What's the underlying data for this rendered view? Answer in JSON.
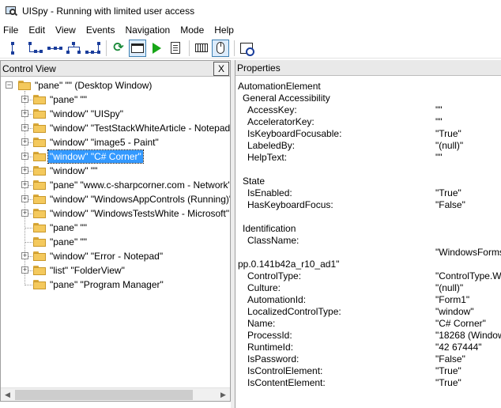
{
  "window": {
    "title": "UISpy - Running with limited user access"
  },
  "menu": [
    "File",
    "Edit",
    "View",
    "Events",
    "Navigation",
    "Mode",
    "Help"
  ],
  "toolbar": {
    "buttons": [
      "parent-icon",
      "first-child-icon",
      "next-sibling-icon",
      "previous-sibling-icon",
      "last-child-icon",
      "refresh-icon",
      "window-icon",
      "play-icon",
      "document-icon",
      "keyboard-icon",
      "mouse-icon",
      "focus-tracking-icon"
    ]
  },
  "control_view": {
    "title": "Control View",
    "close_label": "X",
    "root": "\"pane\" \"\" (Desktop Window)",
    "children": [
      {
        "label": "\"pane\" \"\"",
        "expandable": true
      },
      {
        "label": "\"window\" \"UISpy\"",
        "expandable": true
      },
      {
        "label": "\"window\" \"TestStackWhiteArticle - Notepad\"",
        "expandable": true
      },
      {
        "label": "\"window\" \"image5 - Paint\"",
        "expandable": true
      },
      {
        "label": "\"window\" \"C# Corner\"",
        "expandable": true,
        "selected": true
      },
      {
        "label": "\"window\" \"\"",
        "expandable": true
      },
      {
        "label": "\"pane\" \"www.c-sharpcorner.com - Network\"",
        "expandable": true
      },
      {
        "label": "\"window\" \"WindowsAppControls (Running)\"",
        "expandable": true
      },
      {
        "label": "\"window\" \"WindowsTestsWhite - Microsoft\"",
        "expandable": true
      },
      {
        "label": "\"pane\" \"\"",
        "expandable": false
      },
      {
        "label": "\"pane\" \"\"",
        "expandable": false
      },
      {
        "label": "\"window\" \"Error - Notepad\"",
        "expandable": true
      },
      {
        "label": "\"list\" \"FolderView\"",
        "expandable": true
      },
      {
        "label": "\"pane\" \"Program Manager\"",
        "expandable": false
      }
    ]
  },
  "properties": {
    "title": "Properties",
    "rows": [
      {
        "key": "AutomationElement",
        "value": "",
        "indent": 0
      },
      {
        "key": "General Accessibility",
        "value": "",
        "indent": 1
      },
      {
        "key": "AccessKey:",
        "value": "\"\"",
        "indent": 2
      },
      {
        "key": "AcceleratorKey:",
        "value": "\"\"",
        "indent": 2
      },
      {
        "key": "IsKeyboardFocusable:",
        "value": "\"True\"",
        "indent": 2
      },
      {
        "key": "LabeledBy:",
        "value": "\"(null)\"",
        "indent": 2
      },
      {
        "key": "HelpText:",
        "value": "\"\"",
        "indent": 2
      },
      {
        "key": "",
        "value": "",
        "indent": 0
      },
      {
        "key": "State",
        "value": "",
        "indent": 1
      },
      {
        "key": "IsEnabled:",
        "value": "\"True\"",
        "indent": 2
      },
      {
        "key": "HasKeyboardFocus:",
        "value": "\"False\"",
        "indent": 2
      },
      {
        "key": "",
        "value": "",
        "indent": 0
      },
      {
        "key": "Identification",
        "value": "",
        "indent": 1
      },
      {
        "key": "ClassName:",
        "value": "",
        "indent": 2
      },
      {
        "key": "",
        "value": "\"WindowsForms",
        "indent": 2
      },
      {
        "key": "pp.0.141b42a_r10_ad1\"",
        "value": "",
        "indent": 0
      },
      {
        "key": "ControlType:",
        "value": "\"ControlType.W",
        "indent": 2
      },
      {
        "key": "Culture:",
        "value": "\"(null)\"",
        "indent": 2
      },
      {
        "key": "AutomationId:",
        "value": "\"Form1\"",
        "indent": 2
      },
      {
        "key": "LocalizedControlType:",
        "value": "\"window\"",
        "indent": 2
      },
      {
        "key": "Name:",
        "value": "\"C# Corner\"",
        "indent": 2
      },
      {
        "key": "ProcessId:",
        "value": "\"18268 (Window",
        "indent": 2
      },
      {
        "key": "RuntimeId:",
        "value": "\"42 67444\"",
        "indent": 2
      },
      {
        "key": "IsPassword:",
        "value": "\"False\"",
        "indent": 2
      },
      {
        "key": "IsControlElement:",
        "value": "\"True\"",
        "indent": 2
      },
      {
        "key": "IsContentElement:",
        "value": "\"True\"",
        "indent": 2
      }
    ]
  }
}
